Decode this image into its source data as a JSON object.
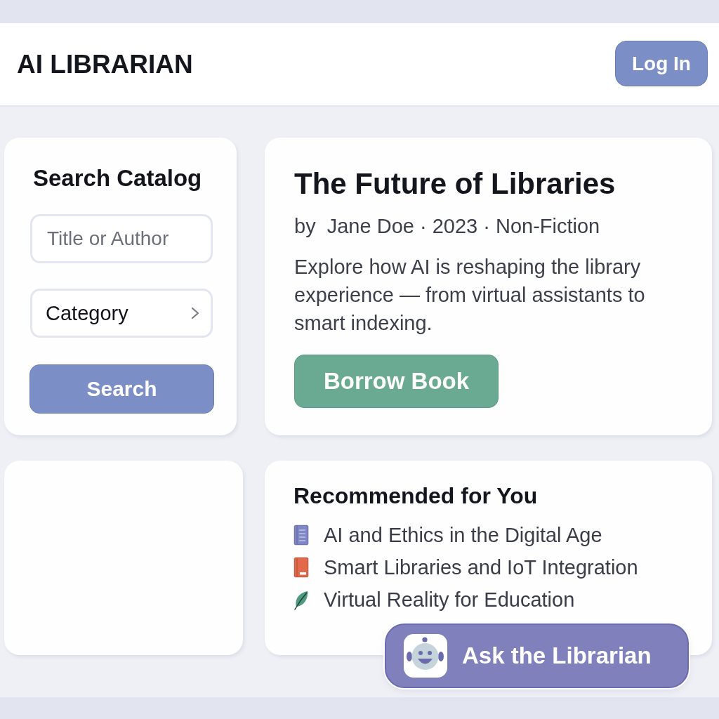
{
  "header": {
    "title": "AI LIBRARIAN",
    "login_button": "Log In"
  },
  "search_panel": {
    "title": "Search Catalog",
    "title_field": {
      "placeholder": "Title or Author"
    },
    "category_select": {
      "value": "Category"
    },
    "search_button": "Search"
  },
  "featured_book": {
    "title": "The Future of Libraries",
    "meta": "by  Jane Doe · 2023 · Non-Fiction",
    "description": "Explore how AI is reshaping the library experience — from virtual assistants to smart indexing.",
    "borrow_button": "Borrow Book"
  },
  "recommendations": {
    "title": "Recommended for You",
    "items": [
      {
        "kind": "book",
        "color": "#7f87c6",
        "title": "AI and Ethics in the Digital Age"
      },
      {
        "kind": "book",
        "color": "#e2694a",
        "title": "Smart Libraries and IoT Integration"
      },
      {
        "kind": "leaf",
        "color": "#4f9a80",
        "title": "Virtual Reality for Education"
      }
    ]
  },
  "assistant_button": {
    "label": "Ask the Librarian"
  }
}
